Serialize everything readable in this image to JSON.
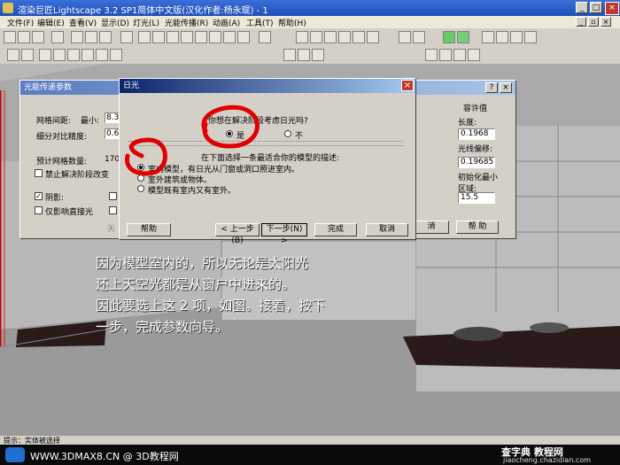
{
  "window": {
    "title": "渲染巨匠Lightscape 3.2 SP1简体中文版(汉化作者:杨永琨) - 1"
  },
  "menu": [
    "文件(F)",
    "编辑(E)",
    "查看(V)",
    "显示(D)",
    "灯光(L)",
    "光能传播(R)",
    "动画(A)",
    "工具(T)",
    "帮助(H)"
  ],
  "energy_panel": {
    "title": "光能传递参数",
    "mesh_spacing_label": "网格间距:",
    "min_label": "最小:",
    "min_value": "8.3",
    "subdiv_label": "细分对比精度:",
    "subdiv_value": "0.6",
    "est_label": "预计网格数量:",
    "est_value": "170",
    "disable_resolve": "禁止解决阶段改变",
    "shadow": "阴影:",
    "direct_only": "仅影响直接光",
    "right_group": "容许值",
    "length_label": "长度:",
    "length_value": "0.1968",
    "offset_label": "光线偏移:",
    "offset_value": "0.19685",
    "init_min_label": "初始化最小区域:",
    "init_min_value": "15.5",
    "cancel": "消",
    "help": "帮 助",
    "small_text": "天"
  },
  "daylight": {
    "title": "日光",
    "question": "你想在解决阶段考虑日光吗?",
    "yes": "是",
    "no": "不",
    "instruction": "在下面选择一条最适合你的模型的描述:",
    "options": [
      "室内模型，有日光从门窗或洞口照进室内。",
      "室外建筑或物体。",
      "模型既有室内又有室外。"
    ],
    "buttons": {
      "help": "帮助",
      "back": "< 上一步(B)",
      "next": "下一步(N) >",
      "finish": "完成",
      "cancel": "取消"
    }
  },
  "caption": [
    "因为模型室内的，所以无论是太阳光",
    "还上天空光都是从窗户中进来的。",
    "因此要选上这 2 项，如图。接着，按下",
    "一步，完成参数向导。"
  ],
  "status": "提示：实体被选择",
  "footer": {
    "site": "WWW.3DMAX8.CN @ 3D教程网",
    "watermark": "查字典 教程网",
    "watermark_url": "jiaocheng.chazidian.com"
  }
}
